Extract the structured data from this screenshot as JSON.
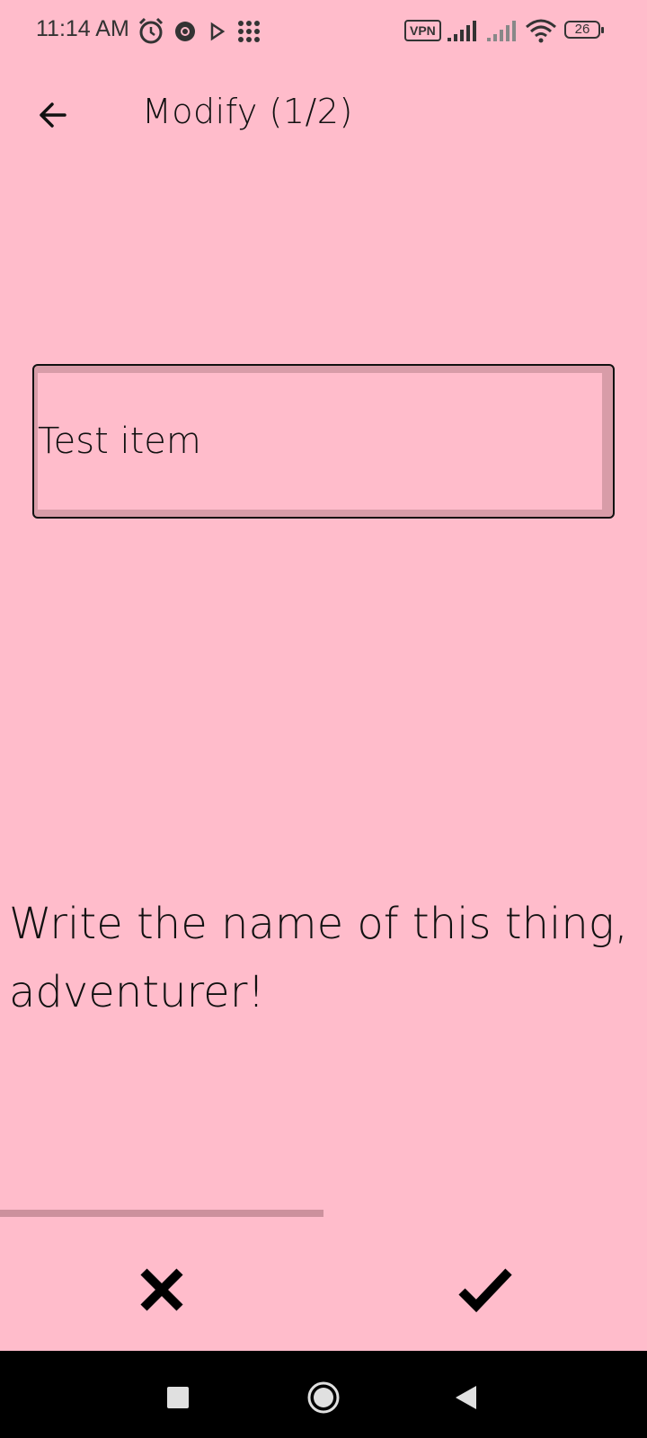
{
  "status_bar": {
    "time": "11:14 AM",
    "vpn": "VPN",
    "battery": "26",
    "icons": [
      "alarm-icon",
      "chrome-icon",
      "play-icon",
      "apps-grid-icon",
      "signal-icon",
      "signal-weak-icon",
      "wifi-icon",
      "battery-icon"
    ]
  },
  "toolbar": {
    "title": "Modify (1/2)",
    "back_icon": "arrow-left-icon"
  },
  "name_field": {
    "value": "Test item"
  },
  "prompt": {
    "text": "Write the name of this thing, adventurer!"
  },
  "progress": {
    "fraction": 0.5
  },
  "actions": {
    "cancel_icon": "close-icon",
    "confirm_icon": "check-icon"
  },
  "nav_bar": {
    "icons": [
      "recent-apps-icon",
      "home-icon",
      "back-icon"
    ]
  },
  "colors": {
    "background": "#ffbccb",
    "progress": "#cc919d",
    "field_border": "#d89ca8",
    "nav_bar": "#000000"
  }
}
